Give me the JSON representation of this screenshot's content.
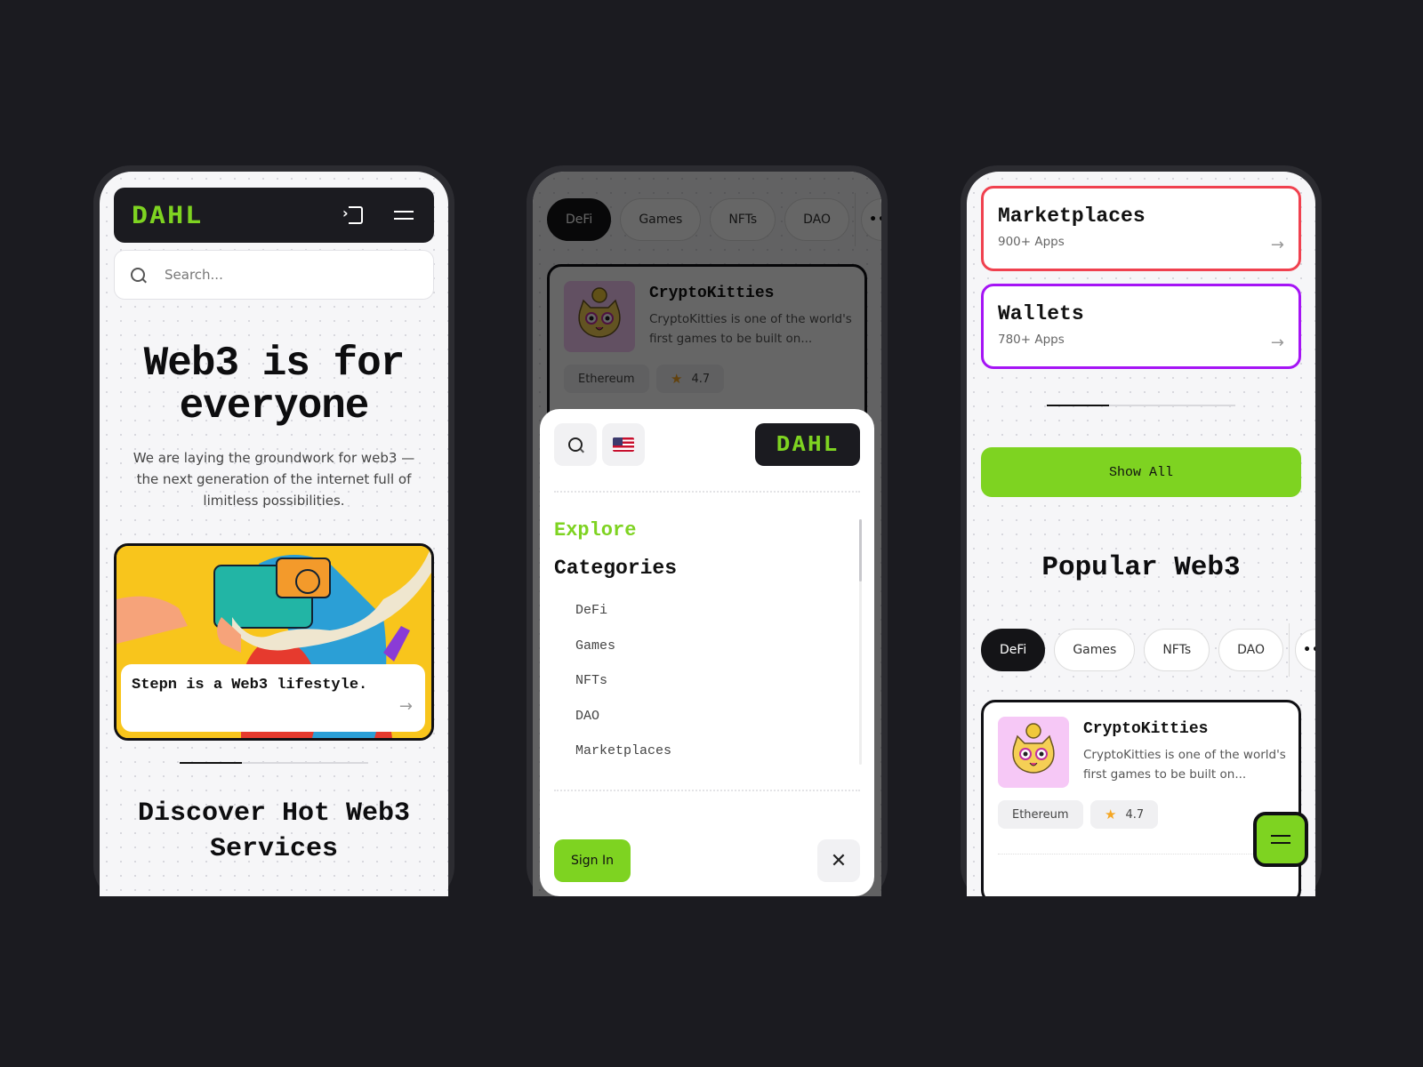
{
  "brand": {
    "logo": "DAHL",
    "accent": "#7ed321"
  },
  "phone1": {
    "search_placeholder": "Search...",
    "hero_title": "Web3 is for everyone",
    "hero_subtitle": "We are laying the groundwork for web3 — the next generation of the internet full of limitless possibilities.",
    "feature_caption": "Stepn is a Web3 lifestyle.",
    "pager_progress": 0.33,
    "section_title": "Discover Hot Web3 Services"
  },
  "phone2": {
    "chips": [
      {
        "label": "DeFi",
        "active": true
      },
      {
        "label": "Games",
        "active": false
      },
      {
        "label": "NFTs",
        "active": false
      },
      {
        "label": "DAO",
        "active": false
      }
    ],
    "more_label": "•••",
    "app": {
      "name": "CryptoKitties",
      "description": "CryptoKitties is one of the world's first games to be built on...",
      "chain": "Ethereum",
      "rating": "4.7"
    },
    "drawer": {
      "explore": "Explore",
      "categories_title": "Categories",
      "categories": [
        "DeFi",
        "Games",
        "NFTs",
        "DAO",
        "Marketplaces"
      ],
      "sign_in": "Sign In",
      "close": "✕"
    }
  },
  "phone3": {
    "cards": [
      {
        "name": "Marketplaces",
        "count": "900+ Apps",
        "color": "#f0414f"
      },
      {
        "name": "Wallets",
        "count": "780+ Apps",
        "color": "#a514f5"
      }
    ],
    "pager_progress": 0.33,
    "show_all": "Show All",
    "section_title": "Popular Web3",
    "chips": [
      {
        "label": "DeFi",
        "active": true
      },
      {
        "label": "Games",
        "active": false
      },
      {
        "label": "NFTs",
        "active": false
      },
      {
        "label": "DAO",
        "active": false
      }
    ],
    "more_label": "•••",
    "app": {
      "name": "CryptoKitties",
      "description": "CryptoKitties is one of the world's first games to be built on...",
      "chain": "Ethereum",
      "rating": "4.7"
    }
  },
  "icons": {
    "arrow": "→",
    "star": "★"
  }
}
